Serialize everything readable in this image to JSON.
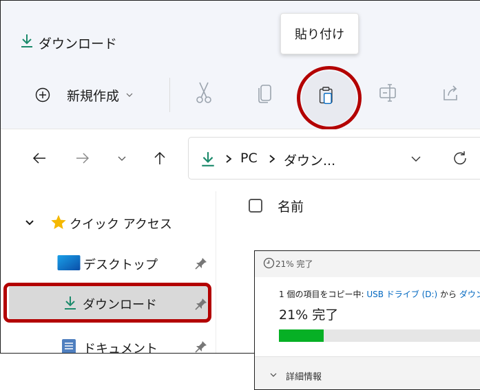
{
  "window": {
    "title": "ダウンロード",
    "title_icon": "download-arrow-icon"
  },
  "tooltip": {
    "text": "貼り付け"
  },
  "toolbar": {
    "new_label": "新規作成",
    "icons": [
      "cut-icon",
      "copy-icon",
      "paste-icon",
      "rename-icon",
      "share-icon"
    ]
  },
  "address": {
    "crumbs": [
      "PC",
      "ダウン..."
    ]
  },
  "nav_pane": {
    "quick_access": "クイック アクセス",
    "items": [
      {
        "label": "デスクトップ",
        "icon": "desktop-folder-icon"
      },
      {
        "label": "ダウンロード",
        "icon": "download-arrow-icon",
        "selected": true
      },
      {
        "label": "ドキュメント",
        "icon": "documents-folder-icon"
      }
    ]
  },
  "content": {
    "column_name": "名前"
  },
  "copy_dialog": {
    "title": "21% 完了",
    "desc_prefix": "1 個の項目をコピー中: ",
    "desc_source": "USB ドライブ (D:)",
    "desc_mid": " から ",
    "desc_dest": "ダウン",
    "percent_text": "21% 完了",
    "progress": 0.21,
    "details_label": "詳細情報"
  },
  "colors": {
    "accent_green": "#06b025",
    "highlight_red": "#b30000",
    "link_blue": "#0067c0"
  }
}
